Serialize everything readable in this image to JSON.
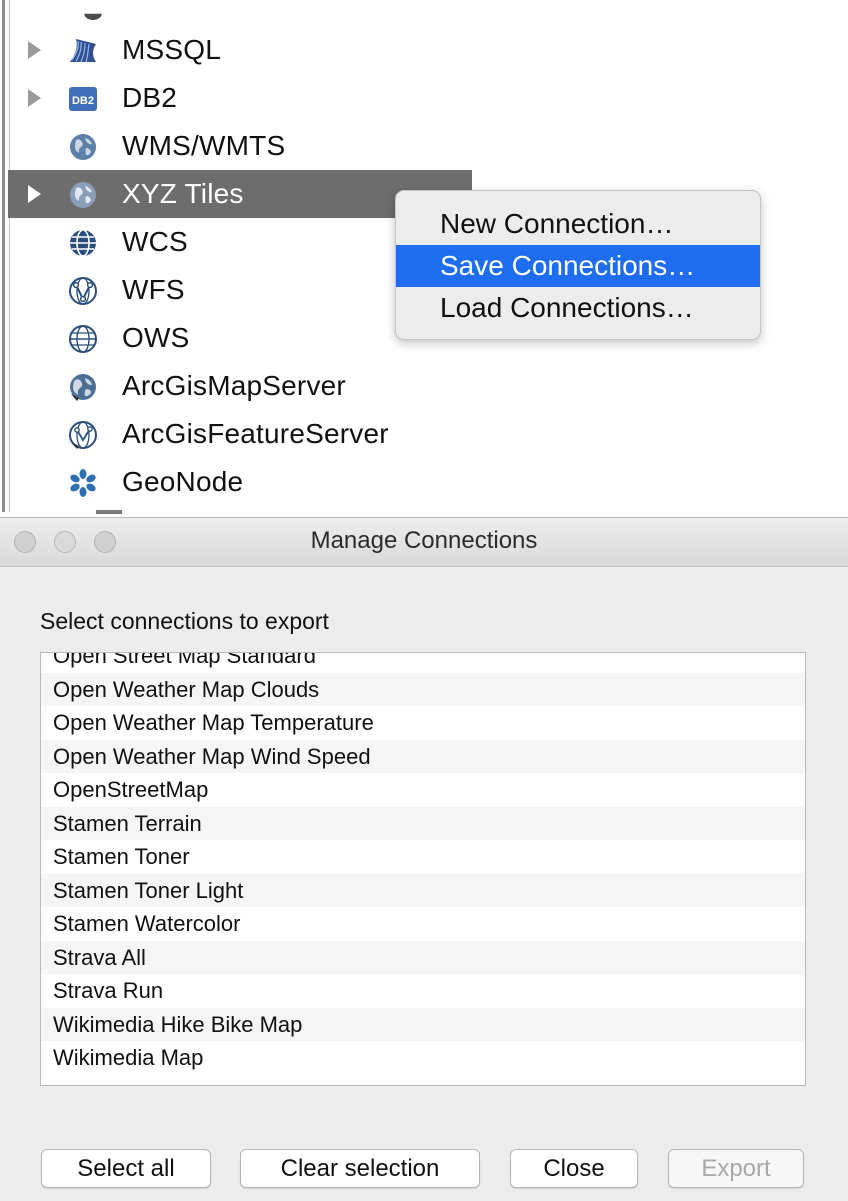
{
  "tree": {
    "items": [
      {
        "label": "MSSQL",
        "icon": "mssql-icon",
        "expandable": true,
        "selected": false
      },
      {
        "label": "DB2",
        "icon": "db2-icon",
        "icon_text": "DB2",
        "expandable": true,
        "selected": false
      },
      {
        "label": "WMS/WMTS",
        "icon": "globe-icon",
        "expandable": false,
        "selected": false
      },
      {
        "label": "XYZ Tiles",
        "icon": "globe-icon",
        "expandable": true,
        "selected": true
      },
      {
        "label": "WCS",
        "icon": "wcs-globe-icon",
        "expandable": false,
        "selected": false
      },
      {
        "label": "WFS",
        "icon": "wfs-globe-icon",
        "expandable": false,
        "selected": false
      },
      {
        "label": "OWS",
        "icon": "ows-globe-icon",
        "expandable": false,
        "selected": false
      },
      {
        "label": "ArcGisMapServer",
        "icon": "arcgis-map-icon",
        "expandable": false,
        "selected": false
      },
      {
        "label": "ArcGisFeatureServer",
        "icon": "arcgis-feature-icon",
        "expandable": false,
        "selected": false
      },
      {
        "label": "GeoNode",
        "icon": "geonode-icon",
        "expandable": false,
        "selected": false
      }
    ]
  },
  "context_menu": {
    "items": [
      {
        "label": "New Connection…",
        "highlighted": false
      },
      {
        "label": "Save Connections…",
        "highlighted": true
      },
      {
        "label": "Load Connections…",
        "highlighted": false
      }
    ]
  },
  "dialog": {
    "title": "Manage Connections",
    "prompt": "Select connections to export",
    "connections": [
      "Open Street Map Standard",
      "Open Weather Map Clouds",
      "Open Weather Map Temperature",
      "Open Weather Map Wind Speed",
      "OpenStreetMap",
      "Stamen Terrain",
      "Stamen Toner",
      "Stamen Toner Light",
      "Stamen Watercolor",
      "Strava All",
      "Strava Run",
      "Wikimedia Hike Bike Map",
      "Wikimedia Map"
    ],
    "buttons": {
      "select_all": "Select all",
      "clear_selection": "Clear selection",
      "close": "Close",
      "export": "Export"
    },
    "export_enabled": false
  },
  "colors": {
    "selection_gray": "#6d6d6d",
    "menu_highlight": "#1e6cf0",
    "dialog_bg": "#ececec"
  }
}
